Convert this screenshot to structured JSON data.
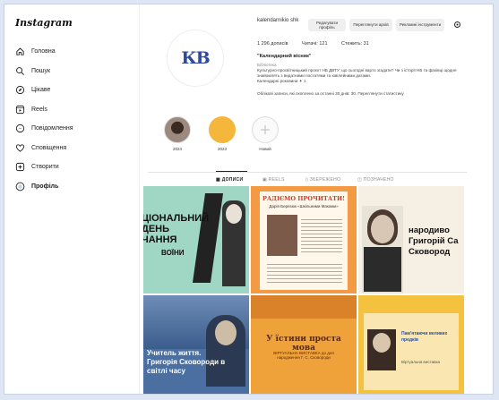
{
  "app": {
    "logo": "Instagram"
  },
  "sidebar": {
    "items": [
      {
        "label": "Головна",
        "icon": "home-icon"
      },
      {
        "label": "Пошук",
        "icon": "search-icon"
      },
      {
        "label": "Цікаве",
        "icon": "compass-icon"
      },
      {
        "label": "Reels",
        "icon": "reels-icon"
      },
      {
        "label": "Повідомлення",
        "icon": "messenger-icon"
      },
      {
        "label": "Сповіщення",
        "icon": "heart-icon"
      },
      {
        "label": "Створити",
        "icon": "plus-square-icon"
      },
      {
        "label": "Профіль",
        "icon": "profile-avatar-icon"
      }
    ]
  },
  "profile": {
    "username": "kalendarnikio shk",
    "buttons": {
      "edit": "Редагувати профіль",
      "archive": "Переглянути архів",
      "ads": "Рекламні інструменти"
    },
    "stats": {
      "posts": "1 296 дописів",
      "followers": "Читачі: 121",
      "following": "Стежить: 31"
    },
    "name": "\"Календарний вісник\"",
    "category": "Бібліотека",
    "bio": "Культурно-просвітницький проєкт НБ ДВТУ: що сьогодні варто згадати? Чи з історії НБ та фахівці щодня знайомлять з видатними постатями та ювілейними датами.",
    "bio_more": "Календарні роковини ✦ 1",
    "insights": "Облікові записи, які охоплено за останні 30 днів: 30. Переглянути статистику",
    "avatar_text": "КВ"
  },
  "highlights": [
    {
      "label": "2024"
    },
    {
      "label": "2023"
    },
    {
      "label": "Новий"
    }
  ],
  "tabs": [
    {
      "label": "ДОПИСИ"
    },
    {
      "label": "REELS"
    },
    {
      "label": "ЗБЕРЕЖЕНО"
    },
    {
      "label": "ПОЗНАЧЕНО"
    }
  ],
  "posts": [
    {
      "text": "ЦІОНАЛЬНИЙ\nДЕНЬ\nЧАННЯ",
      "sub": "ВОЇНИ"
    },
    {
      "text": "РАДІЄМО ПРОЧИТАТИ!",
      "sub": "Дарія Березюк «Шкільними Маками»"
    },
    {
      "text": "народиво\nГригорій Са\nСковород",
      "sub": ""
    },
    {
      "text": "Учитель життя.\nГригорія Сковороди в\nсвітлі часу",
      "sub": ""
    },
    {
      "text": "У їстини проста мова",
      "sub": "ВІРТУАЛЬНА ВИСТАВКА до дня народження Г. С. Сковороди"
    },
    {
      "text": "Пам'ятаючи великих\nпредків",
      "sub": "Віртуальна виставка"
    }
  ],
  "colors": {
    "accent": "#0095f6",
    "tile_green": "#9fd6c4",
    "tile_orange": "#f5a623"
  }
}
